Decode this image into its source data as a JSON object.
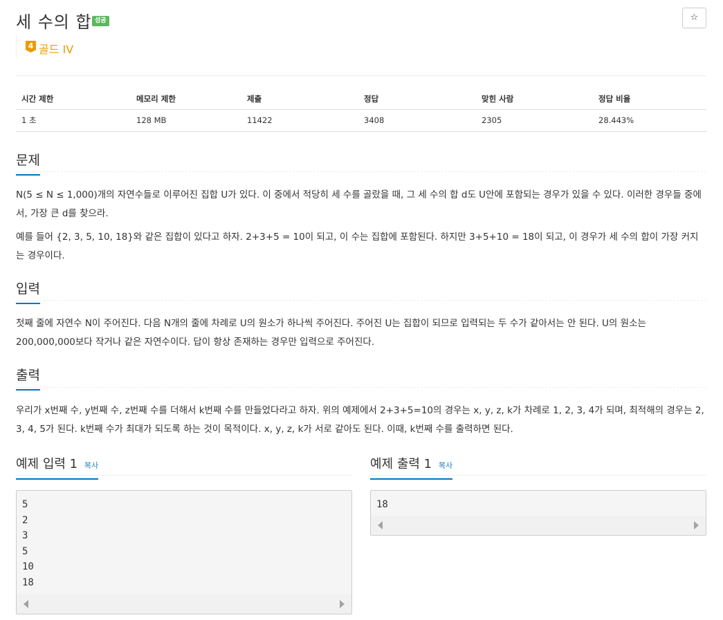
{
  "problem": {
    "title": "세 수의 합",
    "status_badge": "성공",
    "star": "☆",
    "tier_number": "4",
    "tier_label": "골드 IV"
  },
  "info_table": {
    "headers": [
      "시간 제한",
      "메모리 제한",
      "제출",
      "정답",
      "맞힌 사람",
      "정답 비율"
    ],
    "values": [
      "1 초",
      "128 MB",
      "11422",
      "3408",
      "2305",
      "28.443%"
    ]
  },
  "sections": {
    "problem": {
      "heading": "문제",
      "paragraphs": [
        "N(5 ≤ N ≤ 1,000)개의 자연수들로 이루어진 집합 U가 있다. 이 중에서 적당히 세 수를 골랐을 때, 그 세 수의 합 d도 U안에 포함되는 경우가 있을 수 있다. 이러한 경우들 중에서, 가장 큰 d를 찾으라.",
        "예를 들어 {2, 3, 5, 10, 18}와 같은 집합이 있다고 하자. 2+3+5 = 10이 되고, 이 수는 집합에 포함된다. 하지만 3+5+10 = 18이 되고, 이 경우가 세 수의 합이 가장 커지는 경우이다."
      ]
    },
    "input": {
      "heading": "입력",
      "paragraph": "첫째 줄에 자연수 N이 주어진다. 다음 N개의 줄에 차례로 U의 원소가 하나씩 주어진다. 주어진 U는 집합이 되므로 입력되는 두 수가 같아서는 안 된다. U의 원소는 200,000,000보다 작거나 같은 자연수이다. 답이 항상 존재하는 경우만 입력으로 주어진다."
    },
    "output": {
      "heading": "출력",
      "paragraph": "우리가 x번째 수, y번째 수, z번째 수를 더해서 k번째 수를 만들었다라고 하자. 위의 예제에서 2+3+5=10의 경우는 x, y, z, k가 차례로 1, 2, 3, 4가 되며, 최적해의 경우는 2, 3, 4, 5가 된다. k번째 수가 최대가 되도록 하는 것이 목적이다. x, y, z, k가 서로 같아도 된다. 이때, k번째 수를 출력하면 된다."
    }
  },
  "samples": {
    "input": {
      "heading": "예제 입력 1",
      "copy_label": "복사",
      "content": "5\n2\n3\n5\n10\n18"
    },
    "output": {
      "heading": "예제 출력 1",
      "copy_label": "복사",
      "content": "18"
    }
  },
  "colors": {
    "badge_success": "#5cb85c",
    "tier_gold": "#ec9a00",
    "heading_underline": "#0076c0",
    "link_blue": "#2780b9"
  }
}
